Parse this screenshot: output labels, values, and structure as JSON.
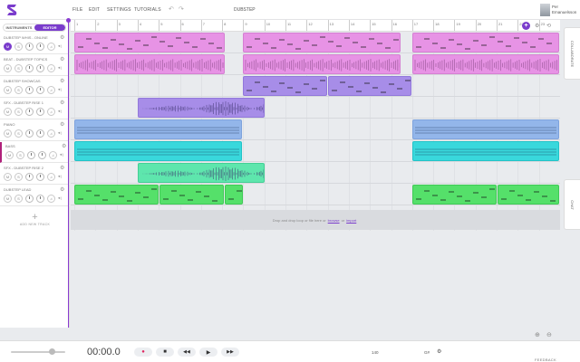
{
  "app": {
    "title": "Soundtrap-style DAW"
  },
  "menu": {
    "file": "FILE",
    "edit": "EDIT",
    "settings": "SETTINGS",
    "tutorials": "TUTORIALS"
  },
  "history": {
    "undo": "↶",
    "redo": "↷"
  },
  "project": {
    "name": "DUBSTEP"
  },
  "user": {
    "first": "Per",
    "last": "Emanuelsson"
  },
  "panel": {
    "tabs": [
      {
        "label": "INSTRUMENTS",
        "active": false
      },
      {
        "label": "EDITOR",
        "active": true
      }
    ],
    "add_track": "ADD NEW TRACK"
  },
  "tracks": [
    {
      "name": "DUBSTEP WHIS - ONLINE",
      "selected": false
    },
    {
      "name": "BEAT - DUBSTEP TOPICS",
      "selected": false
    },
    {
      "name": "DUBSTEP SHOWCAS",
      "selected": false
    },
    {
      "name": "SFX - DUBSTEP RISE 1",
      "selected": false
    },
    {
      "name": "PIANO",
      "selected": false
    },
    {
      "name": "BASS",
      "selected": true
    },
    {
      "name": "SFX - DUBSTEP RISE 2",
      "selected": false
    },
    {
      "name": "DUBSTEP LEAD",
      "selected": false
    }
  ],
  "track_controls": {
    "mute": "M",
    "solo": "S",
    "volume_icon": "◄)"
  },
  "ruler": {
    "labels": [
      "1",
      "2",
      "3",
      "4",
      "5",
      "6",
      "7",
      "8",
      "9",
      "10",
      "11",
      "12",
      "13",
      "14",
      "15",
      "16",
      "17",
      "18",
      "19",
      "20",
      "21",
      "22",
      "23"
    ]
  },
  "drop_hint": {
    "before": "Drop and drop loop or file here or",
    "link1": "browse",
    "mid": "or",
    "link2": "import"
  },
  "side_tabs": {
    "top": "COLLABORATE",
    "bottom": "CHAT"
  },
  "transport": {
    "time": "00:00.0",
    "bpm": "140",
    "key": "G#",
    "record": "●",
    "stop": "■",
    "rewind": "◀◀",
    "play": "▶",
    "forward": "▶▶"
  },
  "footer": {
    "feedback": "FEEDBACK"
  },
  "colors": {
    "accent": "#7a3ccc",
    "pink": "#e793e5",
    "lavender": "#a78de8",
    "blue": "#93b6ea",
    "cyan": "#39d8dc",
    "mint": "#5ee6ad",
    "green": "#55e06a"
  }
}
